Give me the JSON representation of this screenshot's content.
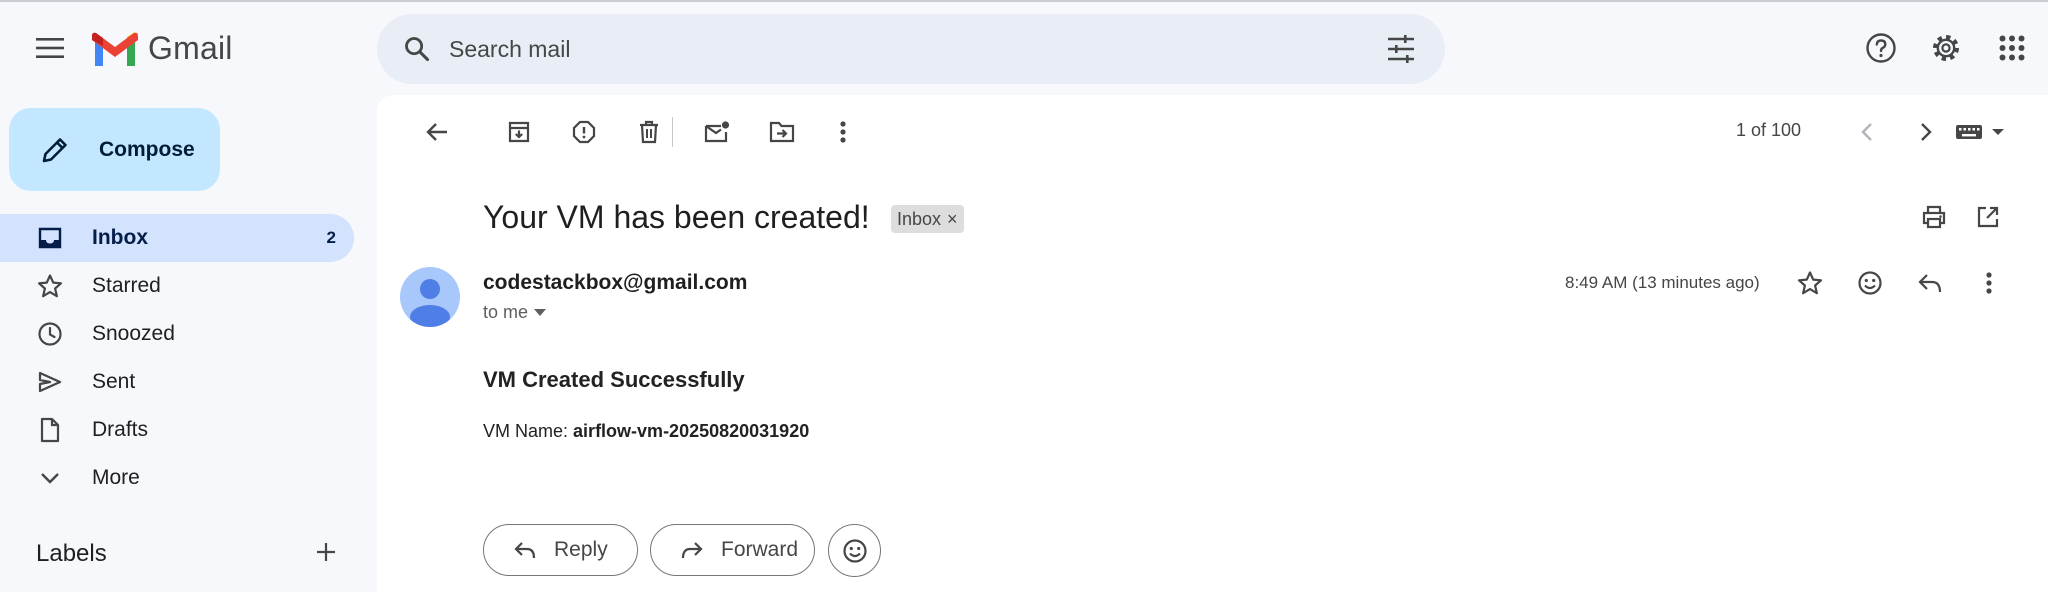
{
  "app": {
    "name": "Gmail"
  },
  "search": {
    "placeholder": "Search mail"
  },
  "compose": {
    "label": "Compose"
  },
  "sidebar": {
    "items": [
      {
        "label": "Inbox",
        "count": "2"
      },
      {
        "label": "Starred"
      },
      {
        "label": "Snoozed"
      },
      {
        "label": "Sent"
      },
      {
        "label": "Drafts"
      },
      {
        "label": "More"
      }
    ],
    "labels_heading": "Labels"
  },
  "toolbar": {
    "pager": "1 of 100"
  },
  "email": {
    "subject": "Your VM has been created!",
    "label_chip": "Inbox",
    "sender": "codestackbox@gmail.com",
    "recipient": "to me",
    "time": "8:49 AM (13 minutes ago)",
    "body_title": "VM Created Successfully",
    "vm_name_label": "VM Name:",
    "vm_name_value": "airflow-vm-20250820031920"
  },
  "actions": {
    "reply": "Reply",
    "forward": "Forward"
  },
  "colors": {
    "accent": "#0b57d0",
    "compose_bg": "#c2e7ff",
    "active_nav": "#d3e3fd",
    "page_bg": "#f6f8fc"
  }
}
